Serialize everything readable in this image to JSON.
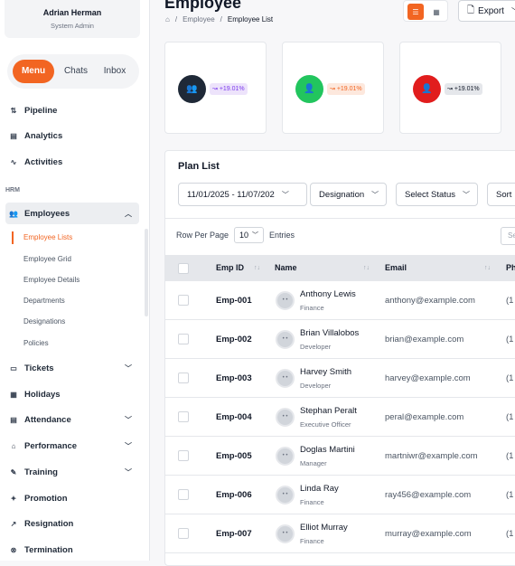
{
  "user": {
    "name": "Adrian Herman",
    "role": "System Admin"
  },
  "sidebar": {
    "tabs": [
      "Menu",
      "Chats",
      "Inbox"
    ],
    "items_top": [
      "Pipeline",
      "Analytics",
      "Activities"
    ],
    "section": "HRM",
    "employees": {
      "label": "Employees",
      "sub": [
        "Employee Lists",
        "Employee Grid",
        "Employee Details",
        "Departments",
        "Designations",
        "Policies"
      ]
    },
    "items_bottom": [
      "Tickets",
      "Holidays",
      "Attendance",
      "Performance",
      "Training",
      "Promotion",
      "Resignation",
      "Termination"
    ]
  },
  "header": {
    "title": "Employee",
    "breadcrumb": [
      "Employee",
      "Employee List"
    ],
    "export": "Export"
  },
  "stats": [
    {
      "badge": "+19.01%",
      "color": "#1f2937"
    },
    {
      "badge": "+19.01%",
      "color": "#22c55e"
    },
    {
      "badge": "+19.01%",
      "color": "#e11d1d"
    }
  ],
  "plan": {
    "title": "Plan List",
    "date_range": "11/01/2025 - 11/07/202",
    "designation": "Designation",
    "status": "Select Status",
    "sort": "Sort",
    "rows_per_page_label": "Row Per Page",
    "rows_per_page_value": "10",
    "entries_label": "Entries",
    "search_placeholder": "Se"
  },
  "table": {
    "columns": [
      "Emp ID",
      "Name",
      "Email",
      "Ph"
    ],
    "rows": [
      {
        "id": "Emp-001",
        "name": "Anthony Lewis",
        "role": "Finance",
        "email": "anthony@example.com",
        "phone": "(1"
      },
      {
        "id": "Emp-002",
        "name": "Brian Villalobos",
        "role": "Developer",
        "email": "brian@example.com",
        "phone": "(1"
      },
      {
        "id": "Emp-003",
        "name": "Harvey Smith",
        "role": "Developer",
        "email": "harvey@example.com",
        "phone": "(1"
      },
      {
        "id": "Emp-004",
        "name": "Stephan Peralt",
        "role": "Executive Officer",
        "email": "peral@example.com",
        "phone": "(1"
      },
      {
        "id": "Emp-005",
        "name": "Doglas Martini",
        "role": "Manager",
        "email": "martniwr@example.com",
        "phone": "(1"
      },
      {
        "id": "Emp-006",
        "name": "Linda Ray",
        "role": "Finance",
        "email": "ray456@example.com",
        "phone": "(1"
      },
      {
        "id": "Emp-007",
        "name": "Elliot Murray",
        "role": "Finance",
        "email": "murray@example.com",
        "phone": "(1"
      }
    ]
  }
}
